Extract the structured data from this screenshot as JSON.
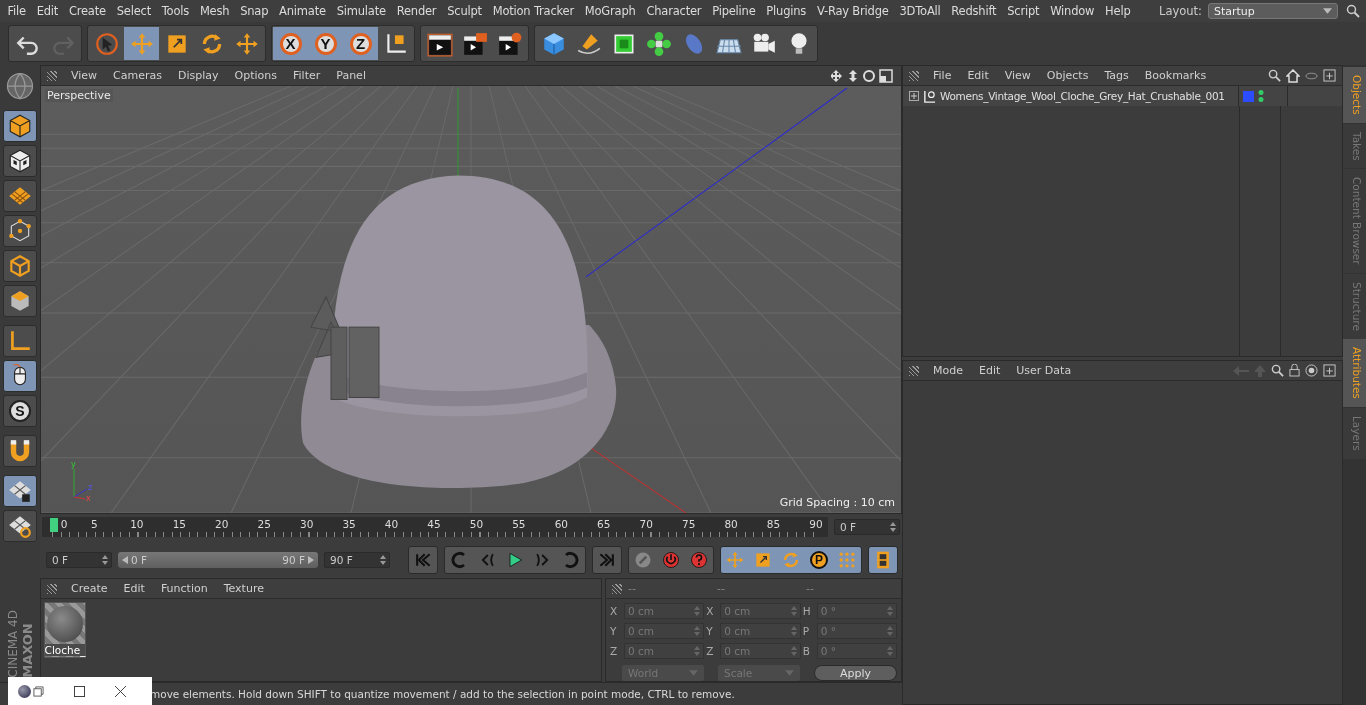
{
  "menubar": {
    "items": [
      "File",
      "Edit",
      "Create",
      "Select",
      "Tools",
      "Mesh",
      "Snap",
      "Animate",
      "Simulate",
      "Render",
      "Sculpt",
      "Motion Tracker",
      "MoGraph",
      "Character",
      "Pipeline",
      "Plugins",
      "V-Ray Bridge",
      "3DToAll",
      "Redshift",
      "Script",
      "Window",
      "Help"
    ],
    "layout_label": "Layout:",
    "layout_value": "Startup"
  },
  "toolbar": {
    "groups": [
      [
        {
          "kind": "undo",
          "selected": false,
          "disabled": false
        },
        {
          "kind": "redo",
          "selected": false,
          "disabled": true
        }
      ],
      [
        {
          "kind": "select",
          "selected": false,
          "disabled": false
        },
        {
          "kind": "move",
          "selected": true,
          "disabled": false
        },
        {
          "kind": "scale",
          "selected": false,
          "disabled": false
        },
        {
          "kind": "rotate",
          "selected": false,
          "disabled": false
        },
        {
          "kind": "move",
          "selected": false,
          "disabled": false
        }
      ],
      [
        {
          "kind": "axis",
          "label": "X",
          "selected": true,
          "disabled": false
        },
        {
          "kind": "axis",
          "label": "Y",
          "selected": true,
          "disabled": false
        },
        {
          "kind": "axis",
          "label": "Z",
          "selected": true,
          "disabled": false
        },
        {
          "kind": "coord",
          "selected": false,
          "disabled": false
        }
      ],
      [
        {
          "kind": "clapper",
          "selected": false,
          "disabled": false
        },
        {
          "kind": "clapper-play",
          "selected": false,
          "disabled": false
        },
        {
          "kind": "clapper-gear",
          "selected": false,
          "disabled": false
        }
      ],
      [
        {
          "kind": "cube",
          "selected": false,
          "disabled": false
        },
        {
          "kind": "pen",
          "selected": false,
          "disabled": false
        },
        {
          "kind": "subdivision",
          "selected": false,
          "disabled": false
        },
        {
          "kind": "cloner",
          "selected": false,
          "disabled": false
        },
        {
          "kind": "bend",
          "selected": false,
          "disabled": false
        },
        {
          "kind": "floor",
          "selected": false,
          "disabled": false
        },
        {
          "kind": "camera",
          "selected": false,
          "disabled": false
        },
        {
          "kind": "light",
          "selected": false,
          "disabled": false
        }
      ]
    ]
  },
  "left_toolbar": [
    {
      "kind": "model",
      "selected": true
    },
    {
      "kind": "texture",
      "selected": false
    },
    {
      "kind": "workplane",
      "selected": false
    },
    {
      "kind": "points",
      "selected": false
    },
    {
      "kind": "edges",
      "selected": false
    },
    {
      "kind": "polygons",
      "selected": false
    },
    {
      "kind": "axis-l",
      "selected": false
    },
    {
      "kind": "tweak",
      "selected": true
    },
    {
      "kind": "snap",
      "label": "S",
      "selected": false
    },
    {
      "kind": "magnet",
      "selected": false
    },
    {
      "kind": "grid-lock",
      "selected": true
    },
    {
      "kind": "workplane-rotate",
      "selected": false
    }
  ],
  "logo": {
    "brand": "MAXON",
    "product": "CINEMA 4D"
  },
  "viewport": {
    "menu": [
      "View",
      "Cameras",
      "Display",
      "Options",
      "Filter",
      "Panel"
    ],
    "camera": "Perspective",
    "grid_spacing": "Grid Spacing : 10 cm",
    "gizmo_labels": [
      "y",
      "z",
      "x"
    ]
  },
  "timeline": {
    "ticks": [
      "0",
      "5",
      "10",
      "15",
      "20",
      "25",
      "30",
      "35",
      "40",
      "45",
      "50",
      "55",
      "60",
      "65",
      "70",
      "75",
      "80",
      "85",
      "90"
    ],
    "level": 0,
    "current_frame": "0 F",
    "start": "0 F",
    "range": {
      "start": "0 F",
      "end": "90 F",
      "level": 1
    },
    "end": "90 F"
  },
  "transport": [
    [
      {
        "kind": "go-start"
      }
    ],
    [
      {
        "kind": "prev-key"
      },
      {
        "kind": "step-back"
      },
      {
        "kind": "play"
      },
      {
        "kind": "step-forward"
      },
      {
        "kind": "next-key"
      }
    ],
    [
      {
        "kind": "go-end"
      }
    ],
    [
      {
        "kind": "record-off"
      },
      {
        "kind": "autokey"
      },
      {
        "kind": "help"
      }
    ],
    [
      {
        "kind": "move"
      },
      {
        "kind": "scale"
      },
      {
        "kind": "rotate"
      },
      {
        "kind": "param",
        "label": "P"
      },
      {
        "kind": "dots"
      }
    ],
    [
      {
        "kind": "film"
      }
    ]
  ],
  "materials": {
    "menu": [
      "Create",
      "Edit",
      "Function",
      "Texture"
    ],
    "items": [
      {
        "name": "Cloche_"
      }
    ]
  },
  "coordinates": {
    "headers": [
      "--",
      "--",
      "--"
    ],
    "rows": [
      [
        {
          "axis": "X",
          "value": "0 cm"
        },
        {
          "axis": "X",
          "value": "0 cm"
        },
        {
          "axis": "H",
          "value": "0 °"
        }
      ],
      [
        {
          "axis": "Y",
          "value": "0 cm"
        },
        {
          "axis": "Y",
          "value": "0 cm"
        },
        {
          "axis": "P",
          "value": "0 °"
        }
      ],
      [
        {
          "axis": "Z",
          "value": "0 cm"
        },
        {
          "axis": "Z",
          "value": "0 cm"
        },
        {
          "axis": "B",
          "value": "0 °"
        }
      ]
    ],
    "mode": "World",
    "size_mode": "Scale",
    "apply": "Apply"
  },
  "status_bar": "move elements. Hold down SHIFT to quantize movement / add to the selection in point mode, CTRL to remove.",
  "objects": {
    "menu": [
      "File",
      "Edit",
      "View",
      "Objects",
      "Tags",
      "Bookmarks"
    ],
    "items": [
      {
        "name": "Womens_Vintage_Wool_Cloche_Grey_Hat_Crushable_001",
        "expanded": false,
        "color": "#2b4cff"
      }
    ]
  },
  "attributes": {
    "menu": [
      "Mode",
      "Edit",
      "User Data"
    ]
  },
  "side_tabs_top": [
    {
      "label": "Objects",
      "selected": true
    },
    {
      "label": "Takes",
      "selected": false
    },
    {
      "label": "Content Browser",
      "selected": false
    },
    {
      "label": "Structure",
      "selected": false
    }
  ],
  "side_tabs_bottom": [
    {
      "label": "Attributes",
      "selected": true
    },
    {
      "label": "Layers",
      "selected": false
    }
  ]
}
